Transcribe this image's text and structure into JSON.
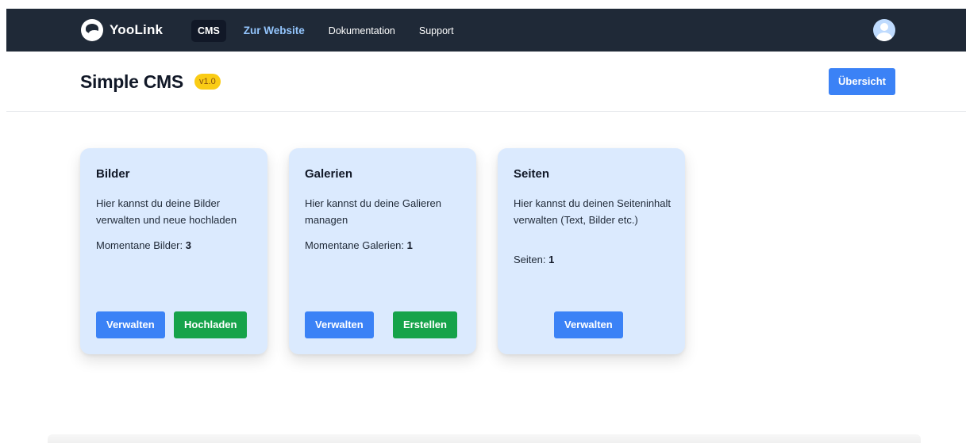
{
  "nav": {
    "brand": "YooLink",
    "links": [
      {
        "label": "CMS"
      },
      {
        "label": "Zur Website"
      },
      {
        "label": "Dokumentation"
      },
      {
        "label": "Support"
      }
    ]
  },
  "header": {
    "title": "Simple CMS",
    "version": "v1.0",
    "overview_label": "Übersicht"
  },
  "cards": [
    {
      "title": "Bilder",
      "description": "Hier kannst du deine Bilder verwalten und neue hochladen",
      "count_label": "Momentane Bilder:",
      "count_value": "3",
      "primary_label": "Verwalten",
      "secondary_label": "Hochladen"
    },
    {
      "title": "Galerien",
      "description": "Hier kannst du deine Galieren managen",
      "count_label": "Momentane Galerien:",
      "count_value": "1",
      "primary_label": "Verwalten",
      "secondary_label": "Erstellen"
    },
    {
      "title": "Seiten",
      "description": "Hier kannst du deinen Seiteninhalt verwalten (Text, Bilder etc.)",
      "count_label": "Seiten:",
      "count_value": "1",
      "primary_label": "Verwalten"
    }
  ],
  "colors": {
    "nav_bg": "#1f2937",
    "accent_blue": "#3b82f6",
    "accent_green": "#16a34a",
    "card_bg": "#dbeafe",
    "badge_yellow": "#facc15"
  }
}
